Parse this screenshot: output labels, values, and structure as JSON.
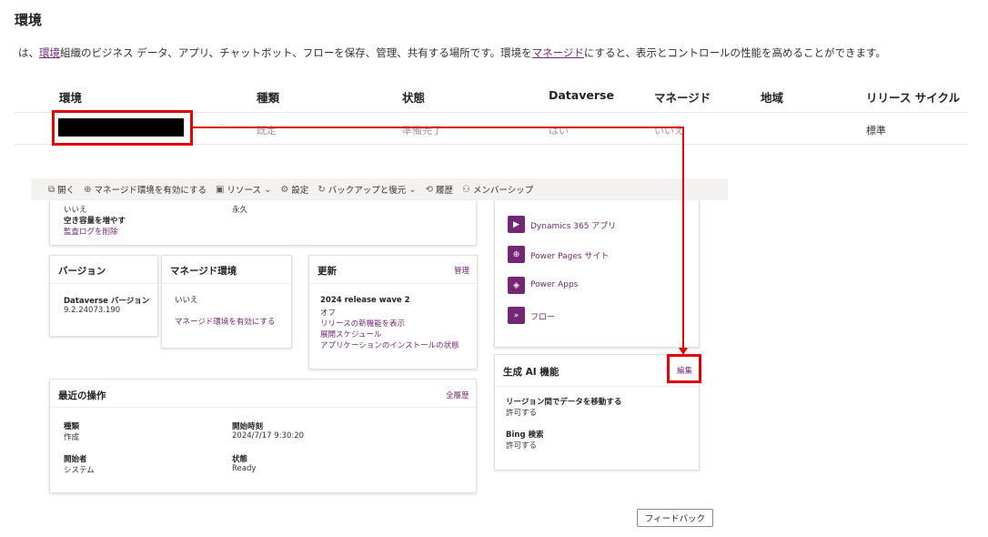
{
  "page": {
    "title": "環境",
    "intro_prefix": "は、",
    "intro_link1": "環境",
    "intro_mid": "組織のビジネス データ、アプリ、チャットボット、フローを保存、管理、共有する場所です。環境を",
    "intro_link2": "マネージド",
    "intro_suffix": "にすると、表示とコントロールの性能を高めることができます。"
  },
  "table": {
    "headers": [
      "環境",
      "種類",
      "状態",
      "Dataverse",
      "マネージド",
      "地域",
      "リリース サイクル"
    ],
    "row": {
      "more": "···",
      "type": "既定",
      "state": "準備完了",
      "dataverse": "はい",
      "managed": "いいえ",
      "region": "",
      "release": "標準"
    }
  },
  "toolbar": {
    "items": [
      {
        "icon": "open-icon",
        "label": "開く"
      },
      {
        "icon": "managed-icon",
        "label": "マネージド環境を有効にする"
      },
      {
        "icon": "resources-icon",
        "label": "リソース"
      },
      {
        "icon": "settings-icon",
        "label": "設定"
      },
      {
        "icon": "backup-icon",
        "label": "バックアップと復元"
      },
      {
        "icon": "history-icon",
        "label": "履歴"
      },
      {
        "icon": "membership-icon",
        "label": "メンバーシップ"
      }
    ]
  },
  "top_card": {
    "val1": "いいえ",
    "val2": "永久",
    "label_storage": "空き容量を増やす",
    "link_audit": "監査ログを削除"
  },
  "apps_card": {
    "items": [
      "Dynamics 365 アプリ",
      "Power Pages サイト",
      "Power Apps",
      "フロー"
    ]
  },
  "version_card": {
    "title": "バージョン",
    "label": "Dataverse バージョン",
    "value": "9.2.24073.190"
  },
  "managed_card": {
    "title": "マネージド環境",
    "value": "いいえ",
    "link": "マネージド環境を有効にする"
  },
  "update_card": {
    "title": "更新",
    "manage": "管理",
    "label": "2024 release wave 2",
    "value": "オフ",
    "link1": "リリースの新機能を表示",
    "link2": "展開スケジュール",
    "link3": "アプリケーションのインストールの状態"
  },
  "ai_card": {
    "title": "生成 AI 機能",
    "edit": "編集",
    "label1": "リージョン間でデータを移動する",
    "value1": "許可する",
    "label2": "Bing 検索",
    "value2": "許可する"
  },
  "recent_card": {
    "title": "最近の操作",
    "history": "全履歴",
    "type_label": "種類",
    "type_value": "作成",
    "start_label": "開始時刻",
    "start_value": "2024/7/17 9:30:20",
    "by_label": "開始者",
    "by_value": "システム",
    "status_label": "状態",
    "status_value": "Ready"
  },
  "feedback": "フィードバック",
  "colors": {
    "accent": "#742774",
    "annotation": "#e00000"
  }
}
